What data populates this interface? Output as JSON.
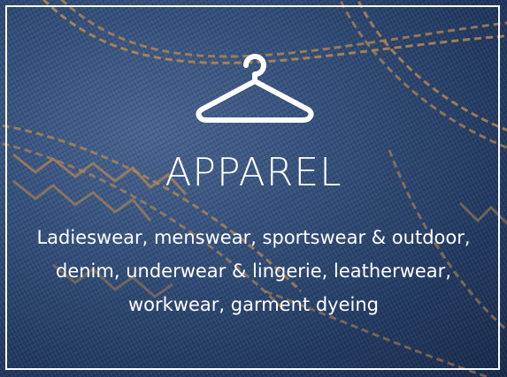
{
  "card": {
    "icon": "hanger-icon",
    "title": "APPAREL",
    "description": "Ladieswear, menswear, sportswear & outdoor, denim, underwear & lingerie, leatherwear, workwear, garment dyeing"
  },
  "colors": {
    "frame": "#ffffff",
    "text": "#ffffff",
    "denim_dark": "#182a4a",
    "denim_light": "#4a6591",
    "stitch": "#b9894f"
  }
}
